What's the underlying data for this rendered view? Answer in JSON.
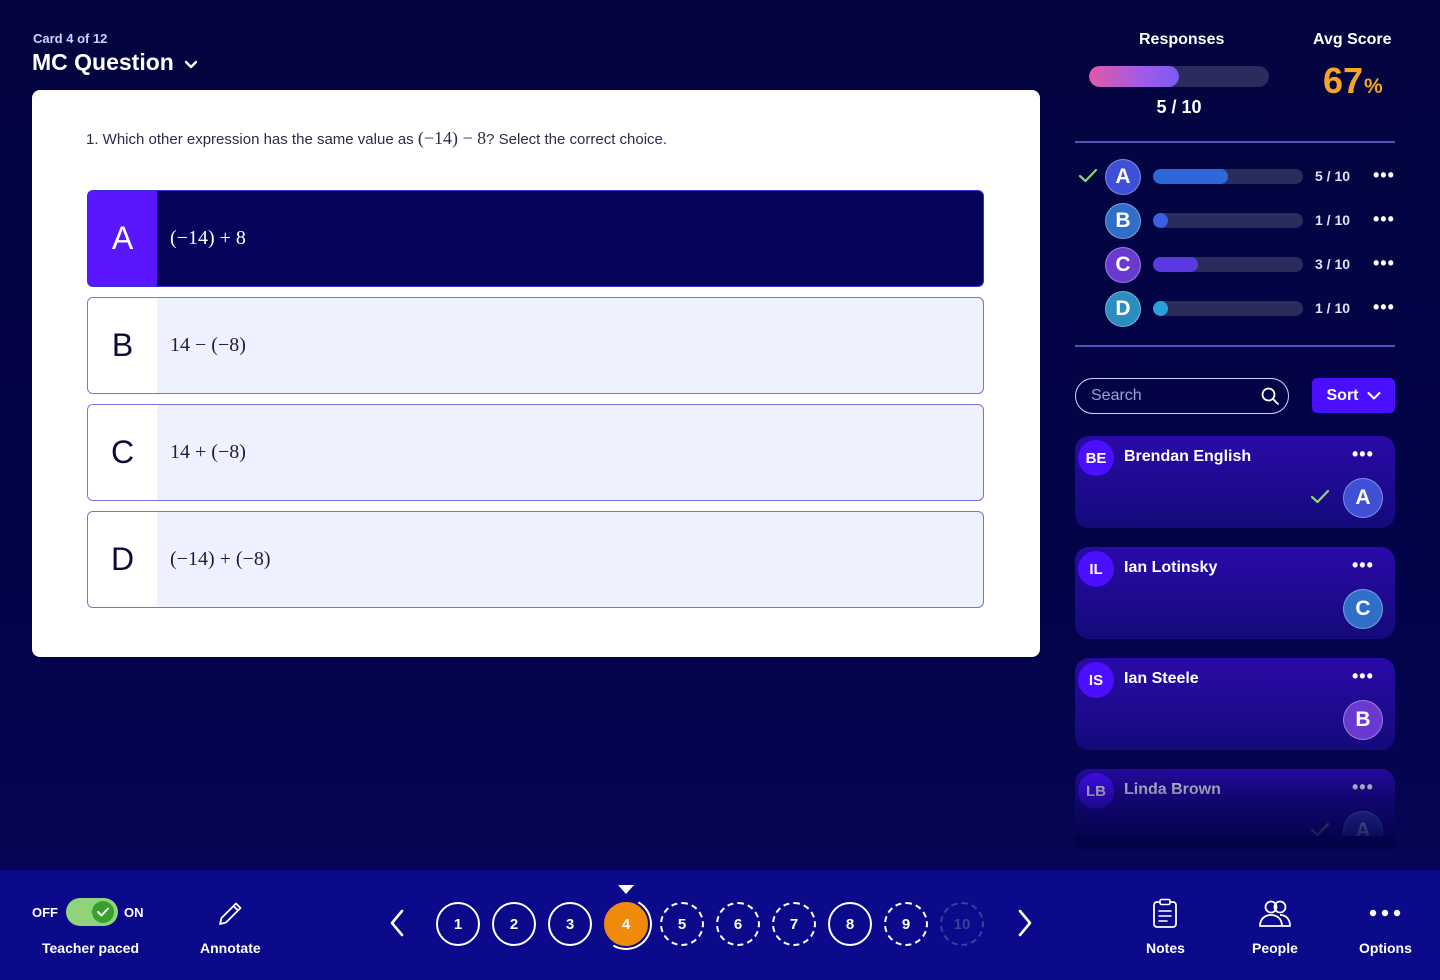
{
  "header": {
    "card_counter": "Card 4 of 12",
    "title": "MC Question"
  },
  "question": {
    "prefix": "1. Which other expression has the same value as ",
    "math": "(−14) − 8",
    "suffix": "? Select the correct choice.",
    "choices": [
      {
        "letter": "A",
        "expr": "(−14) + 8",
        "selected": true
      },
      {
        "letter": "B",
        "expr": "14 − (−8)",
        "selected": false
      },
      {
        "letter": "C",
        "expr": "14 + (−8)",
        "selected": false
      },
      {
        "letter": "D",
        "expr": "(−14) + (−8)",
        "selected": false
      }
    ]
  },
  "stats": {
    "responses_label": "Responses",
    "responses_count": "5 / 10",
    "responses_fraction": 0.5,
    "avg_label": "Avg Score",
    "avg_value": "67",
    "avg_unit": "%"
  },
  "distribution": [
    {
      "letter": "A",
      "count": "5 / 10",
      "fraction": 0.5,
      "color": "#3f4fd6",
      "bar_color": "#2e68d8",
      "correct": true
    },
    {
      "letter": "B",
      "count": "1 / 10",
      "fraction": 0.1,
      "color": "#2f6fc8",
      "bar_color": "#3d5ee0",
      "correct": false
    },
    {
      "letter": "C",
      "count": "3 / 10",
      "fraction": 0.3,
      "color": "#6a3ad0",
      "bar_color": "#5a3ae0",
      "correct": false
    },
    {
      "letter": "D",
      "count": "1 / 10",
      "fraction": 0.1,
      "color": "#2a8ec0",
      "bar_color": "#2aa0d8",
      "correct": false
    }
  ],
  "more_glyph": "•••",
  "search": {
    "placeholder": "Search"
  },
  "sort": {
    "label": "Sort"
  },
  "students": [
    {
      "initials": "BE",
      "name": "Brendan English",
      "answer": "A",
      "answer_color": "#3f4fd6",
      "correct": true
    },
    {
      "initials": "IL",
      "name": "Ian Lotinsky",
      "answer": "C",
      "answer_color": "#2f6fc8",
      "correct": false
    },
    {
      "initials": "IS",
      "name": "Ian Steele",
      "answer": "B",
      "answer_color": "#6a3ad0",
      "correct": false
    },
    {
      "initials": "LB",
      "name": "Linda Brown",
      "answer": "A",
      "answer_color": "#3f4fd6",
      "correct": true
    }
  ],
  "bottom": {
    "toggle_off": "OFF",
    "toggle_on": "ON",
    "teacher_paced": "Teacher paced",
    "annotate": "Annotate",
    "notes": "Notes",
    "people": "People",
    "options": "Options",
    "pages": [
      "1",
      "2",
      "3",
      "4",
      "5",
      "6",
      "7",
      "8",
      "9",
      "10"
    ],
    "current_page": "4"
  }
}
